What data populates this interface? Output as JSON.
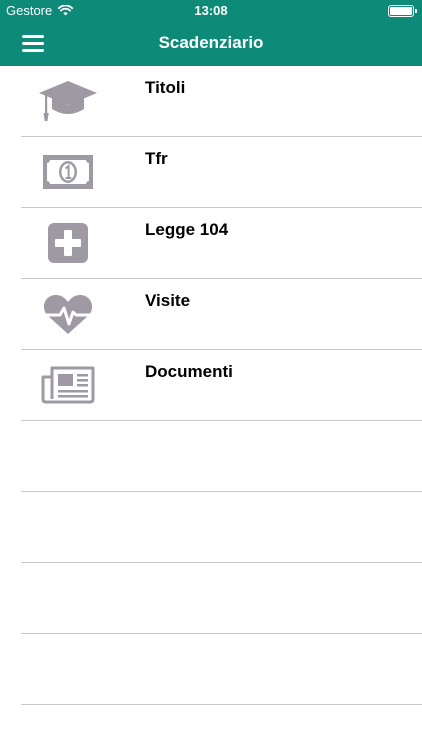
{
  "status_bar": {
    "carrier": "Gestore",
    "time": "13:08"
  },
  "navbar": {
    "title": "Scadenziario"
  },
  "items": [
    {
      "label": "Titoli",
      "icon": "graduation-cap-icon"
    },
    {
      "label": "Tfr",
      "icon": "banknote-icon"
    },
    {
      "label": "Legge 104",
      "icon": "plus-square-icon"
    },
    {
      "label": "Visite",
      "icon": "heartbeat-icon"
    },
    {
      "label": "Documenti",
      "icon": "newspaper-icon"
    }
  ],
  "colors": {
    "header": "#0e8a78",
    "icon": "#9e99a3",
    "separator": "#c8c7cc"
  }
}
